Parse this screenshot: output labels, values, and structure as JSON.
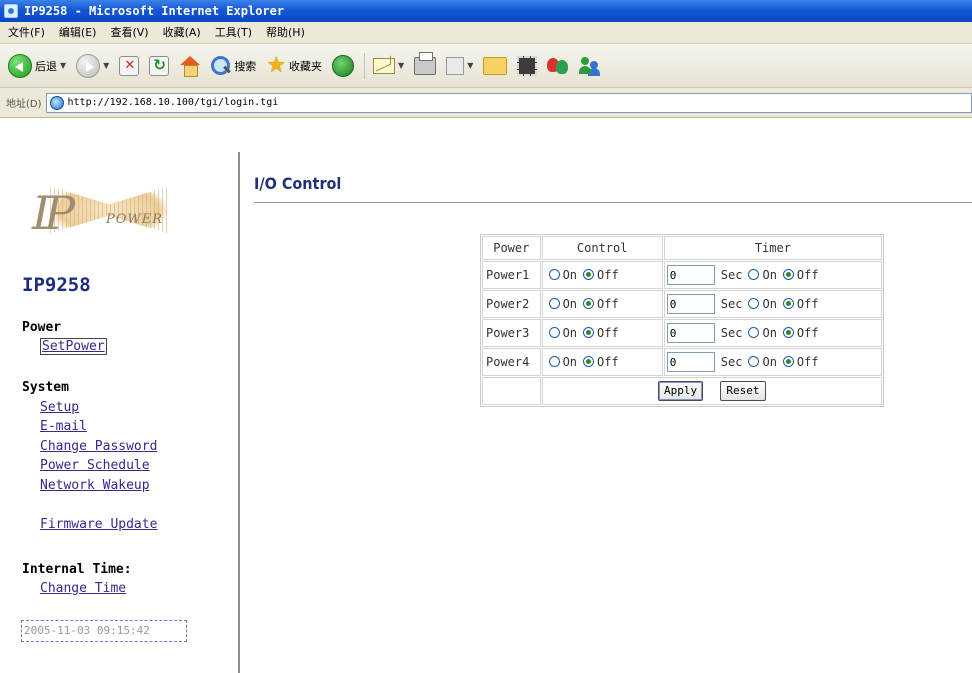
{
  "window": {
    "title": "IP9258 - Microsoft Internet Explorer"
  },
  "menu": [
    "文件(F)",
    "编辑(E)",
    "查看(V)",
    "收藏(A)",
    "工具(T)",
    "帮助(H)"
  ],
  "toolbar": {
    "back_label": "后退",
    "search_label": "搜索",
    "favorites_label": "收藏夹"
  },
  "address": {
    "label": "地址(D)",
    "url": "http://192.168.10.100/tgi/login.tgi"
  },
  "sidebar": {
    "logo_ip": "IP",
    "logo_power": "POWER",
    "device_name": "IP9258",
    "power_heading": "Power",
    "setpower_link": "SetPower",
    "system_heading": "System",
    "system_links": [
      "Setup",
      "E-mail",
      "Change Password",
      "Power Schedule",
      "Network Wakeup"
    ],
    "firmware_link": "Firmware Update",
    "time_heading": "Internal Time:",
    "change_time_link": "Change Time",
    "current_time": "2005-11-03 09:15:42"
  },
  "main": {
    "title": "I/O Control",
    "table": {
      "headers": [
        "Power",
        "Control",
        "Timer"
      ],
      "rows": [
        {
          "label": "Power1",
          "control": "off",
          "seconds": "0",
          "timer_state": "off"
        },
        {
          "label": "Power2",
          "control": "off",
          "seconds": "0",
          "timer_state": "off"
        },
        {
          "label": "Power3",
          "control": "off",
          "seconds": "0",
          "timer_state": "off"
        },
        {
          "label": "Power4",
          "control": "off",
          "seconds": "0",
          "timer_state": "off"
        }
      ],
      "on_label": "On",
      "off_label": "Off",
      "sec_label": "Sec"
    },
    "apply_label": "Apply",
    "reset_label": "Reset"
  },
  "colors": {
    "link": "#322a8e",
    "device_name": "#1c2b86",
    "title": "#22307e",
    "titlebar": "#1458d6"
  }
}
